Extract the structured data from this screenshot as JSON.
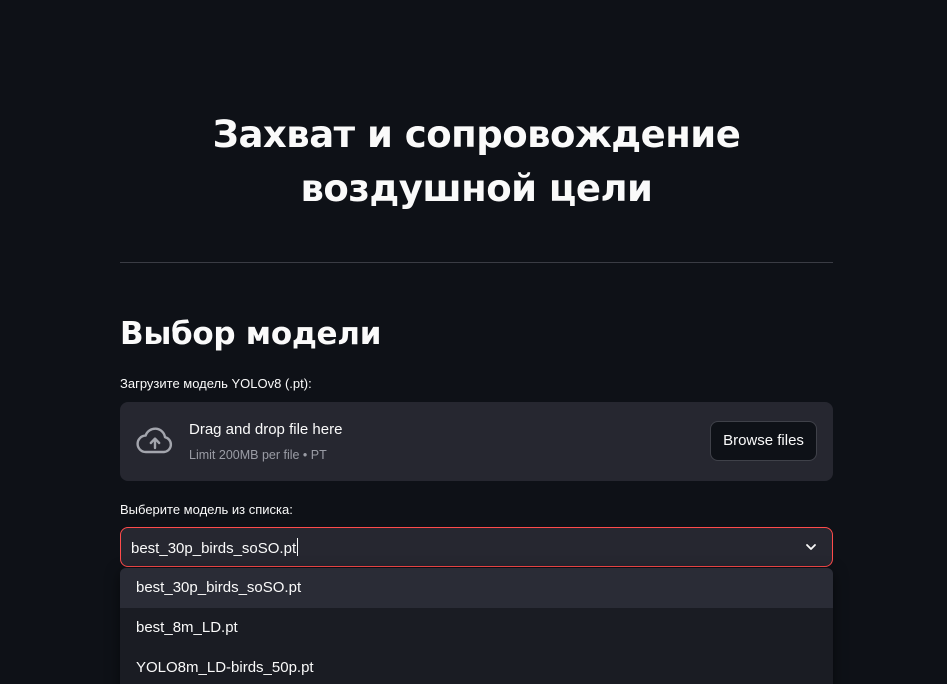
{
  "header": {
    "title_line1": "Захват и сопровождение",
    "title_line2": "воздушной цели"
  },
  "model_section": {
    "title": "Выбор модели",
    "upload_label": "Загрузите модель YOLOv8 (.pt):",
    "uploader": {
      "drop_text": "Drag and drop file here",
      "limit_text": "Limit 200MB per file • PT",
      "browse_label": "Browse files",
      "icon": "cloud-upload-icon"
    },
    "select_label": "Выберите модель из списка:",
    "select": {
      "value": "best_30p_birds_soSO.pt",
      "icon": "chevron-down-icon",
      "options": [
        "best_30p_birds_soSO.pt",
        "best_8m_LD.pt",
        "YOLO8m_LD-birds_50p.pt"
      ]
    }
  },
  "colors": {
    "background": "#0e1117",
    "surface": "#262730",
    "accent": "#ff4b4b",
    "text": "#fafafa",
    "muted": "#9a9ca5"
  }
}
